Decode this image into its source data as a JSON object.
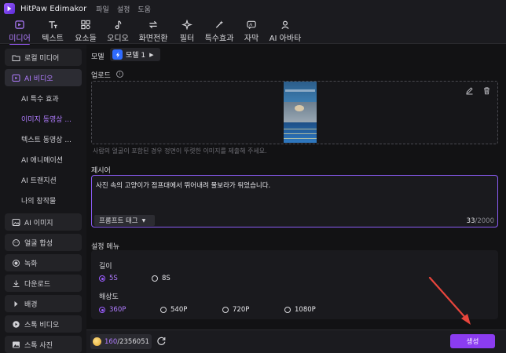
{
  "app": {
    "title": "HitPaw Edimakor",
    "menu": [
      "파일",
      "설정",
      "도움"
    ]
  },
  "toolbar": {
    "tabs": [
      {
        "label": "미디어",
        "icon": "media-icon",
        "active": true
      },
      {
        "label": "텍스트",
        "icon": "text-icon",
        "active": false
      },
      {
        "label": "요소들",
        "icon": "elements-icon",
        "active": false
      },
      {
        "label": "오디오",
        "icon": "audio-icon",
        "active": false
      },
      {
        "label": "화면전환",
        "icon": "transition-icon",
        "active": false
      },
      {
        "label": "필터",
        "icon": "filter-icon",
        "active": false
      },
      {
        "label": "특수효과",
        "icon": "effects-icon",
        "active": false
      },
      {
        "label": "자막",
        "icon": "subtitle-icon",
        "active": false
      },
      {
        "label": "AI 아바타",
        "icon": "avatar-icon",
        "active": false
      }
    ]
  },
  "sidebar": {
    "local_media": "로컬 미디어",
    "ai_video": "AI 비디오",
    "ai_video_items": [
      "AI 특수 효과",
      "이미지 동영상 ...",
      "텍스트 동영상 ...",
      "AI 애니메이션",
      "AI 트랜지션",
      "나의 창작물"
    ],
    "ai_image": "AI 이미지",
    "face_swap": "얼굴 합성",
    "record": "녹화",
    "download": "다운로드",
    "background": "배경",
    "stock_video": "스톡 비디오",
    "stock_photo": "스톡 사진"
  },
  "main": {
    "model_label": "모델",
    "model_value": "모델 1",
    "upload_label": "업로드",
    "upload_hint": "사람의 얼굴이 포함된 경우 정면이 뚜렷한 이미지를 제출해 주세요.",
    "prompt_label": "제시어",
    "prompt_text": "사진 속의 고양이가 점프대에서 뛰어내려 물보라가 튀었습니다.",
    "prompt_tag_button": "프롬프트 태그",
    "prompt_count": "33",
    "prompt_max": "/2000",
    "settings_label": "설정 메뉴",
    "length_label": "길이",
    "length_options": [
      {
        "label": "5S",
        "selected": true
      },
      {
        "label": "8S",
        "selected": false
      }
    ],
    "resolution_label": "해상도",
    "resolution_options": [
      {
        "label": "360P",
        "selected": true
      },
      {
        "label": "540P",
        "selected": false
      },
      {
        "label": "720P",
        "selected": false
      },
      {
        "label": "1080P",
        "selected": false
      }
    ]
  },
  "bottom": {
    "credits_current": "160",
    "credits_total": "/2356051",
    "generate_button": "생성"
  },
  "colors": {
    "accent": "#9b5cff",
    "generate": "#8b3cf0",
    "annotation_arrow": "#e8453c"
  }
}
